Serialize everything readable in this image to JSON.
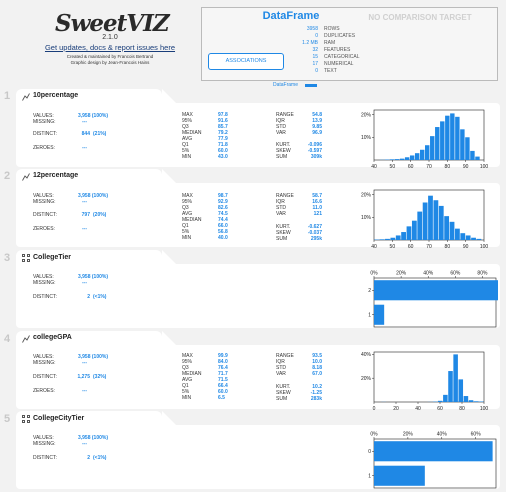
{
  "header": {
    "logo_text": "SweetVIZ",
    "version": "2.1.0",
    "updates_link": "Get updates, docs & report issues here",
    "credit_line1": "Created & maintained by Francois Bertrand",
    "credit_line2": "Graphic design by Jean-Francois Hains"
  },
  "summary": {
    "title": "DataFrame",
    "compare_title": "NO COMPARISON TARGET",
    "associations_button": "ASSOCIATIONS",
    "tag": "DataFrame",
    "rows": [
      {
        "value": "3958",
        "label": "ROWS"
      },
      {
        "value": "0",
        "label": "DUPLICATES"
      },
      {
        "value": "1.2 MB",
        "label": "RAM"
      },
      {
        "value": "32",
        "label": "FEATURES"
      },
      {
        "value": "15",
        "label": "CATEGORICAL"
      },
      {
        "value": "17",
        "label": "NUMERICAL"
      },
      {
        "value": "0",
        "label": "TEXT"
      }
    ]
  },
  "labels": {
    "values": "VALUES:",
    "missing": "MISSING:",
    "distinct": "DISTINCT:",
    "zeroes": "ZEROES:",
    "max": "MAX",
    "p95": "95%",
    "q3": "Q3",
    "median": "MEDIAN",
    "avg": "AVG",
    "q1": "Q1",
    "p5": "5%",
    "min": "MIN",
    "range": "RANGE",
    "iqr": "IQR",
    "std": "STD",
    "var": "VAR",
    "kurt": "KURT.",
    "skew": "SKEW",
    "sum": "SUM"
  },
  "features": [
    {
      "num": "1",
      "name": "10percentage",
      "kind": "numerical",
      "values": "3,958 (100%)",
      "missing": "---",
      "distinct": "844",
      "distinct_pct": "(21%)",
      "zeroes": "---",
      "max": "97.8",
      "p95": "91.6",
      "q3": "85.7",
      "median": "79.2",
      "avg": "77.9",
      "q1": "71.8",
      "p5": "60.0",
      "min": "43.0",
      "range": "54.8",
      "iqr": "13.9",
      "std": "9.85",
      "var": "96.9",
      "kurt": "-0.096",
      "skew": "-0.597",
      "sum": "309k"
    },
    {
      "num": "2",
      "name": "12percentage",
      "kind": "numerical",
      "values": "3,958 (100%)",
      "missing": "---",
      "distinct": "797",
      "distinct_pct": "(20%)",
      "zeroes": "---",
      "max": "98.7",
      "p95": "92.9",
      "q3": "82.6",
      "median": "74.4",
      "avg": "74.5",
      "q1": "66.0",
      "p5": "56.8",
      "min": "40.0",
      "range": "58.7",
      "iqr": "16.6",
      "std": "11.0",
      "var": "121",
      "kurt": "-0.627",
      "skew": "-0.037",
      "sum": "295k"
    },
    {
      "num": "3",
      "name": "CollegeTier",
      "kind": "categorical",
      "values": "3,958 (100%)",
      "missing": "---",
      "distinct": "2",
      "distinct_pct": "(<1%)"
    },
    {
      "num": "4",
      "name": "collegeGPA",
      "kind": "numerical",
      "values": "3,958 (100%)",
      "missing": "---",
      "distinct": "1,275",
      "distinct_pct": "(32%)",
      "zeroes": "---",
      "max": "99.9",
      "p95": "84.0",
      "q3": "76.4",
      "median": "71.7",
      "avg": "71.5",
      "q1": "66.4",
      "p5": "60.0",
      "min": "6.5",
      "range": "93.5",
      "iqr": "10.0",
      "std": "8.18",
      "var": "67.0",
      "kurt": "10.2",
      "skew": "-1.25",
      "sum": "283k"
    },
    {
      "num": "5",
      "name": "CollegeCityTier",
      "kind": "categorical",
      "values": "3,958 (100%)",
      "missing": "---",
      "distinct": "2",
      "distinct_pct": "(<1%)"
    }
  ],
  "chart_data": [
    {
      "type": "bar",
      "title": "",
      "xlabel": "",
      "ylabel": "",
      "x_ticks": [
        40,
        50,
        60,
        70,
        80,
        90,
        100
      ],
      "y_ticks": [
        "10%",
        "20%"
      ],
      "xlim": [
        40,
        100
      ],
      "ylim": [
        0,
        22
      ],
      "bin_start": 43,
      "bin_width": 2.74,
      "values": [
        0.1,
        0.2,
        0.3,
        0.4,
        0.6,
        1.2,
        2.0,
        3.0,
        4.5,
        6.5,
        10.5,
        14.5,
        17.0,
        19.5,
        20.5,
        19.0,
        13.5,
        10.0,
        4.0,
        1.5
      ]
    },
    {
      "type": "bar",
      "title": "",
      "xlabel": "",
      "ylabel": "",
      "x_ticks": [
        40,
        50,
        60,
        70,
        80,
        90,
        100
      ],
      "y_ticks": [
        "10%",
        "20%"
      ],
      "xlim": [
        40,
        100
      ],
      "ylim": [
        0,
        22
      ],
      "bin_start": 40,
      "bin_width": 2.935,
      "values": [
        0.2,
        0.3,
        0.5,
        1.0,
        2.0,
        3.5,
        6.0,
        8.5,
        12.5,
        16.5,
        19.5,
        17.5,
        15.0,
        10.5,
        8.0,
        5.0,
        3.0,
        2.0,
        1.0,
        0.5
      ]
    },
    {
      "type": "bar",
      "orientation": "horizontal",
      "title": "",
      "xlabel": "",
      "ylabel": "",
      "categories": [
        "2",
        "1"
      ],
      "values": [
        92.5,
        7.5
      ],
      "x_ticks": [
        "0%",
        "20%",
        "40%",
        "60%",
        "80%"
      ],
      "xlim": [
        0,
        90
      ]
    },
    {
      "type": "bar",
      "title": "",
      "xlabel": "",
      "ylabel": "",
      "x_ticks": [
        0,
        20,
        40,
        60,
        80,
        100
      ],
      "y_ticks": [
        "20%",
        "40%"
      ],
      "xlim": [
        0,
        100
      ],
      "ylim": [
        0,
        42
      ],
      "bin_start": 6.5,
      "bin_width": 4.67,
      "values": [
        0.1,
        0,
        0,
        0,
        0,
        0,
        0,
        0,
        0,
        0.1,
        0.3,
        1.0,
        6.0,
        26.0,
        40.0,
        19.0,
        5.0,
        1.5,
        0.6,
        0.4
      ]
    },
    {
      "type": "bar",
      "orientation": "horizontal",
      "title": "",
      "xlabel": "",
      "ylabel": "",
      "categories": [
        "0",
        "1"
      ],
      "values": [
        70,
        30
      ],
      "x_ticks": [
        "0%",
        "20%",
        "40%",
        "60%"
      ],
      "xlim": [
        0,
        72
      ]
    }
  ]
}
